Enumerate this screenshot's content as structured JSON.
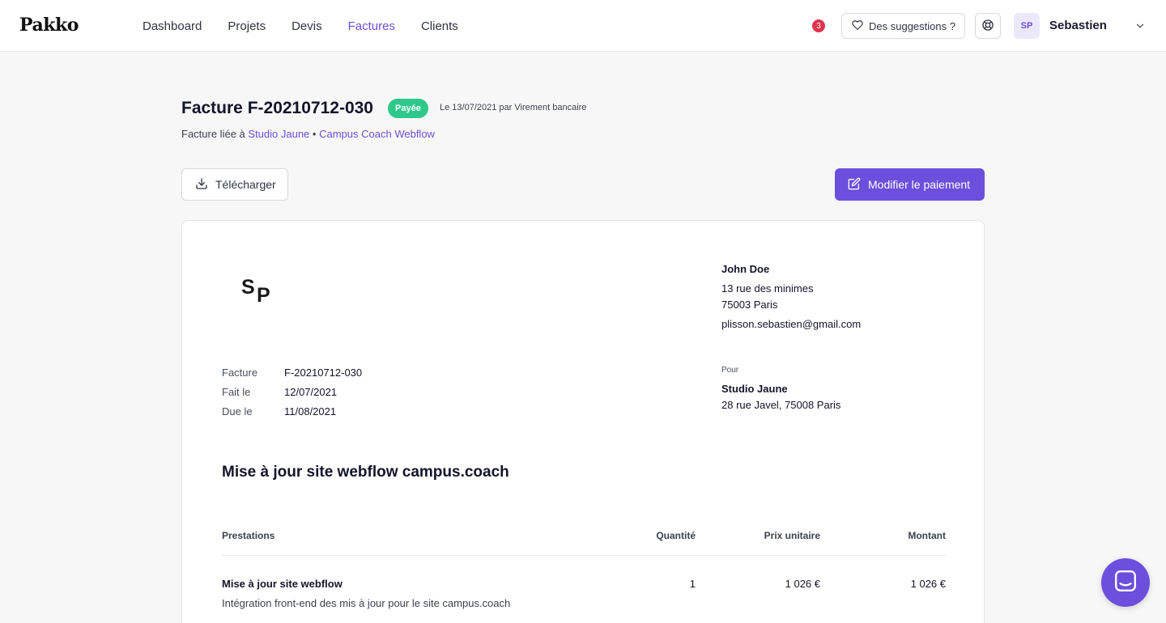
{
  "app": {
    "logo": "Pakko"
  },
  "nav": {
    "items": [
      {
        "label": "Dashboard",
        "active": false
      },
      {
        "label": "Projets",
        "active": false
      },
      {
        "label": "Devis",
        "active": false
      },
      {
        "label": "Factures",
        "active": true
      },
      {
        "label": "Clients",
        "active": false
      }
    ]
  },
  "header": {
    "notification_count": "3",
    "suggestions_label": "Des suggestions ?",
    "avatar_initials": "SP",
    "username": "Sebastien"
  },
  "invoice": {
    "title": "Facture F-20210712-030",
    "status": "Payée",
    "paid_info": "Le 13/07/2021 par Virement bancaire",
    "linked_prefix": "Facture liée à",
    "linked_client": "Studio Jaune",
    "linked_separator": "•",
    "linked_project": "Campus Coach Webflow",
    "download_label": "Télécharger",
    "edit_payment_label": "Modifier le paiement",
    "logo_initials": {
      "s": "S",
      "p": "P"
    },
    "sender": {
      "name": "John Doe",
      "address_line1": "13 rue des minimes",
      "address_line2": "75003 Paris",
      "email": "plisson.sebastien@gmail.com"
    },
    "meta": [
      {
        "label": "Facture",
        "value": "F-20210712-030"
      },
      {
        "label": "Fait le",
        "value": "12/07/2021"
      },
      {
        "label": "Due le",
        "value": "11/08/2021"
      }
    ],
    "recipient": {
      "label": "Pour",
      "name": "Studio Jaune",
      "address": "28 rue Javel, 75008 Paris"
    },
    "subject": "Mise à jour site webflow campus.coach",
    "table": {
      "headers": {
        "service": "Prestations",
        "quantity": "Quantité",
        "unit_price": "Prix unitaire",
        "amount": "Montant"
      },
      "rows": [
        {
          "title": "Mise à jour site webflow",
          "description": "Intégration front-end des mis à jour pour le site campus.coach",
          "quantity": "1",
          "unit_price": "1 026 €",
          "amount": "1 026 €"
        }
      ]
    }
  },
  "colors": {
    "accent": "#6c4fdc",
    "paid": "#2ec98a",
    "notification": "#e0344f"
  }
}
